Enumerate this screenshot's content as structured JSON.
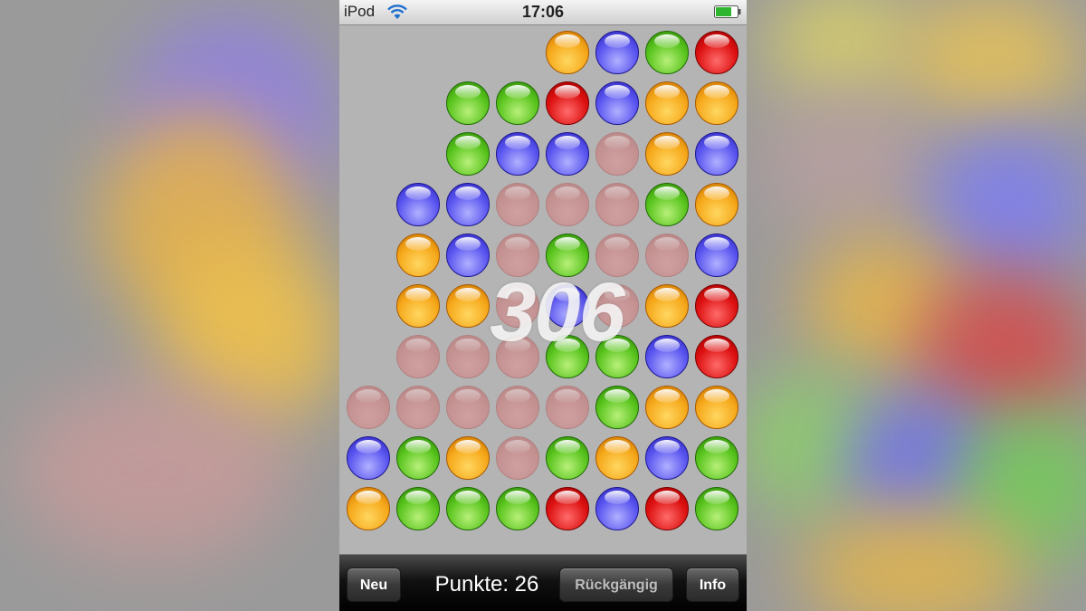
{
  "status": {
    "carrier": "iPod",
    "time": "17:06",
    "icons": [
      "wifi-icon",
      "battery-icon"
    ]
  },
  "board": {
    "rows": [
      [
        "empty",
        "empty",
        "empty",
        "empty",
        "orange",
        "blue",
        "green",
        "red"
      ],
      [
        "empty",
        "empty",
        "green",
        "green",
        "red",
        "blue",
        "orange",
        "orange"
      ],
      [
        "empty",
        "empty",
        "green",
        "blue",
        "blue",
        "ghost",
        "orange",
        "blue"
      ],
      [
        "empty",
        "blue",
        "blue",
        "ghost",
        "ghost",
        "ghost",
        "green",
        "orange"
      ],
      [
        "empty",
        "orange",
        "blue",
        "ghost",
        "green",
        "ghost",
        "ghost",
        "blue"
      ],
      [
        "empty",
        "orange",
        "orange",
        "ghost",
        "blue",
        "ghost",
        "orange",
        "red"
      ],
      [
        "empty",
        "ghost",
        "ghost",
        "ghost",
        "green",
        "green",
        "blue",
        "red"
      ],
      [
        "ghost",
        "ghost",
        "ghost",
        "ghost",
        "ghost",
        "green",
        "orange",
        "orange"
      ],
      [
        "blue",
        "green",
        "orange",
        "ghost",
        "green",
        "orange",
        "blue",
        "green"
      ],
      [
        "orange",
        "green",
        "green",
        "green",
        "red",
        "blue",
        "red",
        "green"
      ]
    ],
    "score_popup": "306"
  },
  "toolbar": {
    "new_label": "Neu",
    "points_label": "Punkte: 26",
    "undo_label": "Rückgängig",
    "info_label": "Info"
  }
}
